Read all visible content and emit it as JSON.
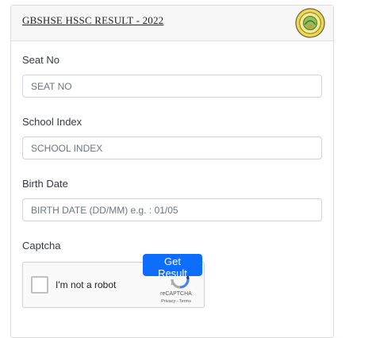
{
  "header": {
    "title": "GBSHSE HSSC RESULT - 2022",
    "logo_icon": "goa-board-seal-icon"
  },
  "form": {
    "seat_no": {
      "label": "Seat No",
      "placeholder": "SEAT NO",
      "value": ""
    },
    "school_index": {
      "label": "School Index",
      "placeholder": "SCHOOL INDEX",
      "value": ""
    },
    "birth_date": {
      "label": "Birth Date",
      "placeholder": "BIRTH DATE (DD/MM) e.g. : 01/05",
      "value": ""
    },
    "captcha": {
      "label": "Captcha",
      "checkbox_text": "I'm not a robot",
      "brand": "reCAPTCHA",
      "links": "Privacy - Terms",
      "icon": "recaptcha-icon"
    },
    "submit_label": "Get Result"
  },
  "colors": {
    "primary": "#0d6efd",
    "header_bg": "#f7f7f8",
    "border": "#ced4da"
  }
}
